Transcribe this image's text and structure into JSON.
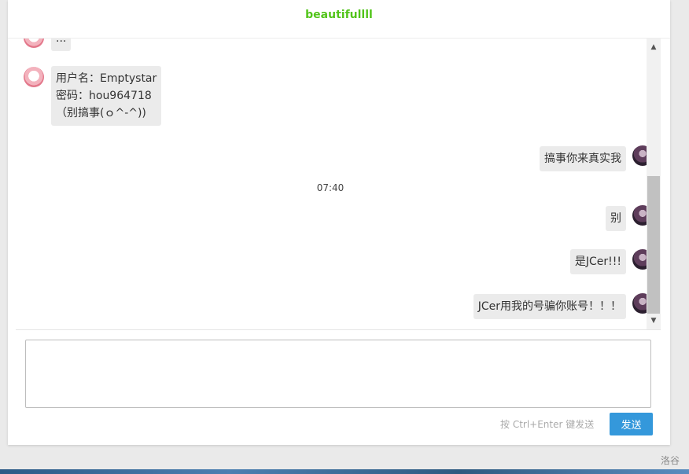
{
  "chat": {
    "title": "beautifullll",
    "messages": [
      {
        "side": "left",
        "avatar": "avatar-pink",
        "text": "..."
      },
      {
        "side": "left",
        "avatar": "avatar-pink",
        "lines": [
          "用户名：Emptystar",
          "密码：hou964718",
          "（别搞事(ｏ^-^))"
        ]
      },
      {
        "side": "right",
        "avatar": "avatar-dark",
        "text": "搞事你来真实我"
      },
      {
        "type": "time",
        "text": "07:40"
      },
      {
        "side": "right",
        "avatar": "avatar-dark",
        "text": "别"
      },
      {
        "side": "right",
        "avatar": "avatar-dark",
        "text": "是JCer!!!"
      },
      {
        "side": "right",
        "avatar": "avatar-dark",
        "text": "JCer用我的号骗你账号！！！"
      }
    ]
  },
  "composer": {
    "value": "",
    "hint": "按 Ctrl+Enter 键发送",
    "send_label": "发送"
  },
  "footer": {
    "brand": "洛谷"
  },
  "icons": {
    "scroll_up": "triangle-up-icon",
    "scroll_down": "triangle-down-icon"
  }
}
